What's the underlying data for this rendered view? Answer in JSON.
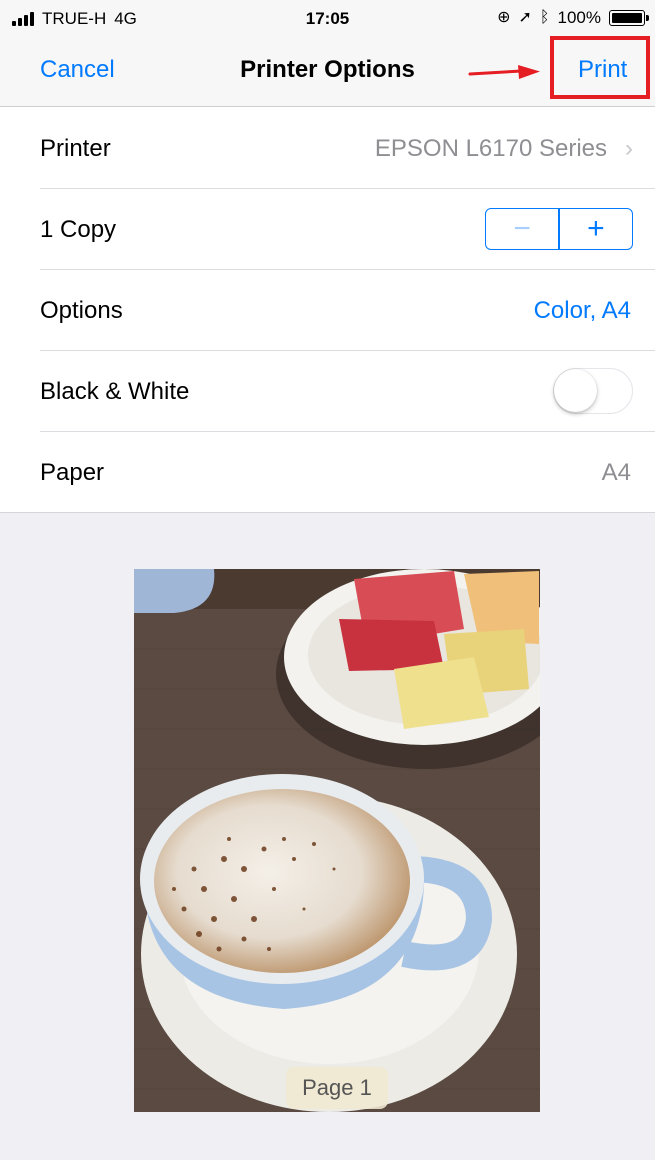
{
  "status_bar": {
    "carrier": "TRUE-H",
    "network": "4G",
    "time": "17:05",
    "battery_percent": "100%",
    "icons": [
      "signal-icon",
      "orientation-lock-icon",
      "location-icon",
      "bluetooth-icon",
      "battery-icon"
    ]
  },
  "nav": {
    "cancel_label": "Cancel",
    "title": "Printer Options",
    "print_label": "Print",
    "accent_color": "#007aff",
    "highlight_color": "#e51e24"
  },
  "settings": {
    "printer": {
      "label": "Printer",
      "value": "EPSON L6170 Series"
    },
    "copies": {
      "label": "1 Copy",
      "minus": "−",
      "plus": "+"
    },
    "options": {
      "label": "Options",
      "value": "Color, A4"
    },
    "black_white": {
      "label": "Black & White",
      "enabled": false
    },
    "paper": {
      "label": "Paper",
      "value": "A4"
    }
  },
  "preview": {
    "page_label": "Page 1"
  }
}
